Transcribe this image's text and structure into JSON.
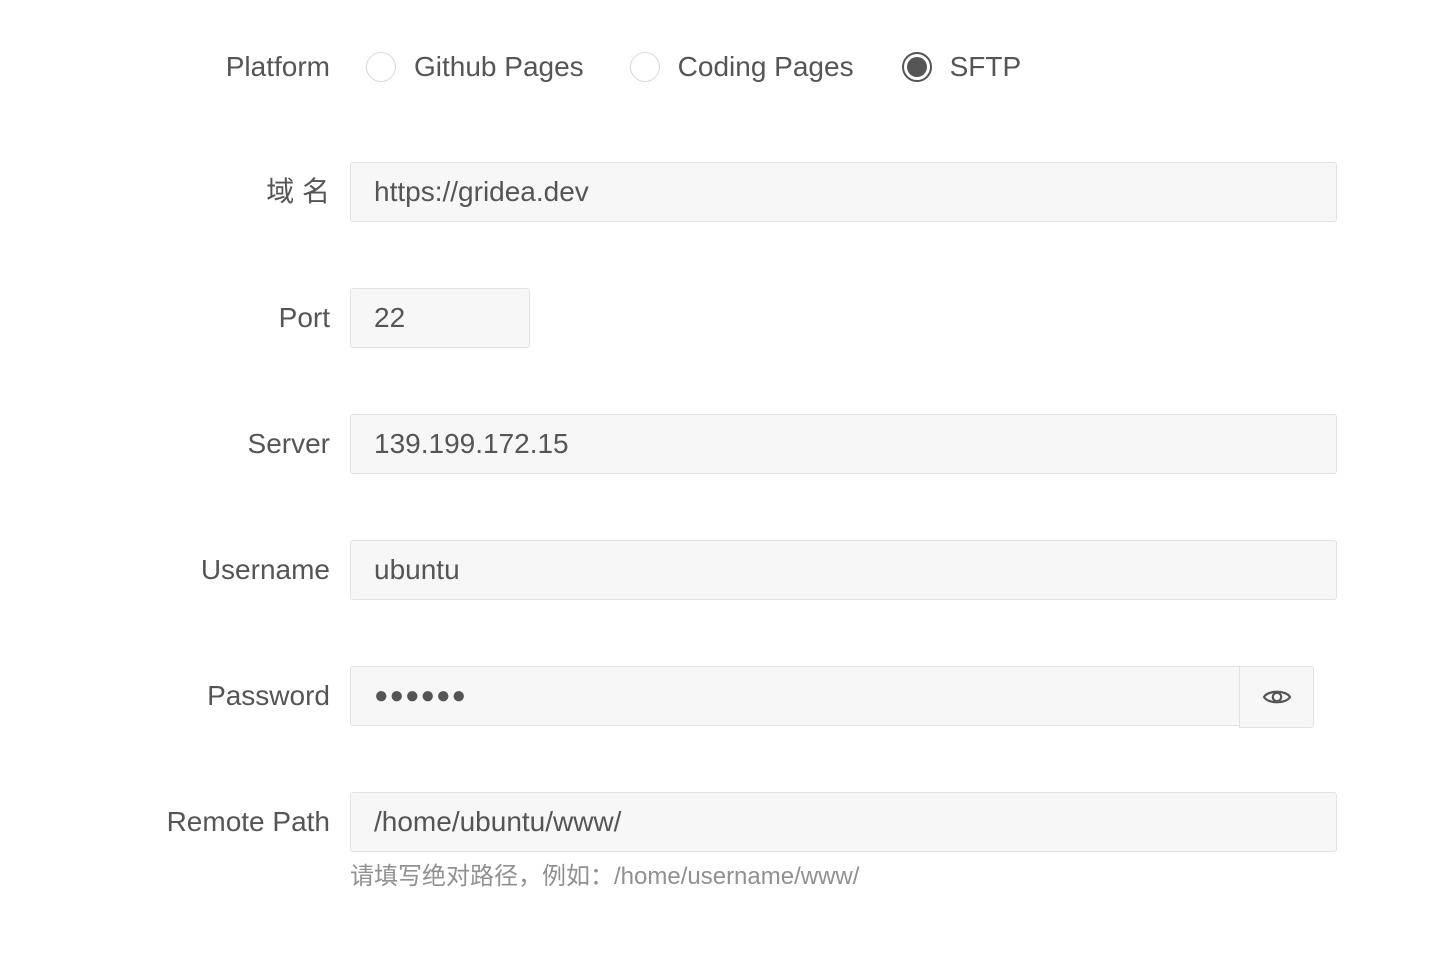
{
  "platform": {
    "label": "Platform",
    "options": [
      {
        "label": "Github Pages",
        "checked": false
      },
      {
        "label": "Coding Pages",
        "checked": false
      },
      {
        "label": "SFTP",
        "checked": true
      }
    ]
  },
  "domain": {
    "label": "域 名",
    "value": "https://gridea.dev"
  },
  "port": {
    "label": "Port",
    "value": "22"
  },
  "server": {
    "label": "Server",
    "value": "139.199.172.15"
  },
  "username": {
    "label": "Username",
    "value": "ubuntu"
  },
  "password": {
    "label": "Password",
    "value": "●●●●●●",
    "toggle_icon": "eye-icon"
  },
  "remote_path": {
    "label": "Remote Path",
    "value": "/home/ubuntu/www/",
    "help": "请填写绝对路径，例如：/home/username/www/"
  }
}
